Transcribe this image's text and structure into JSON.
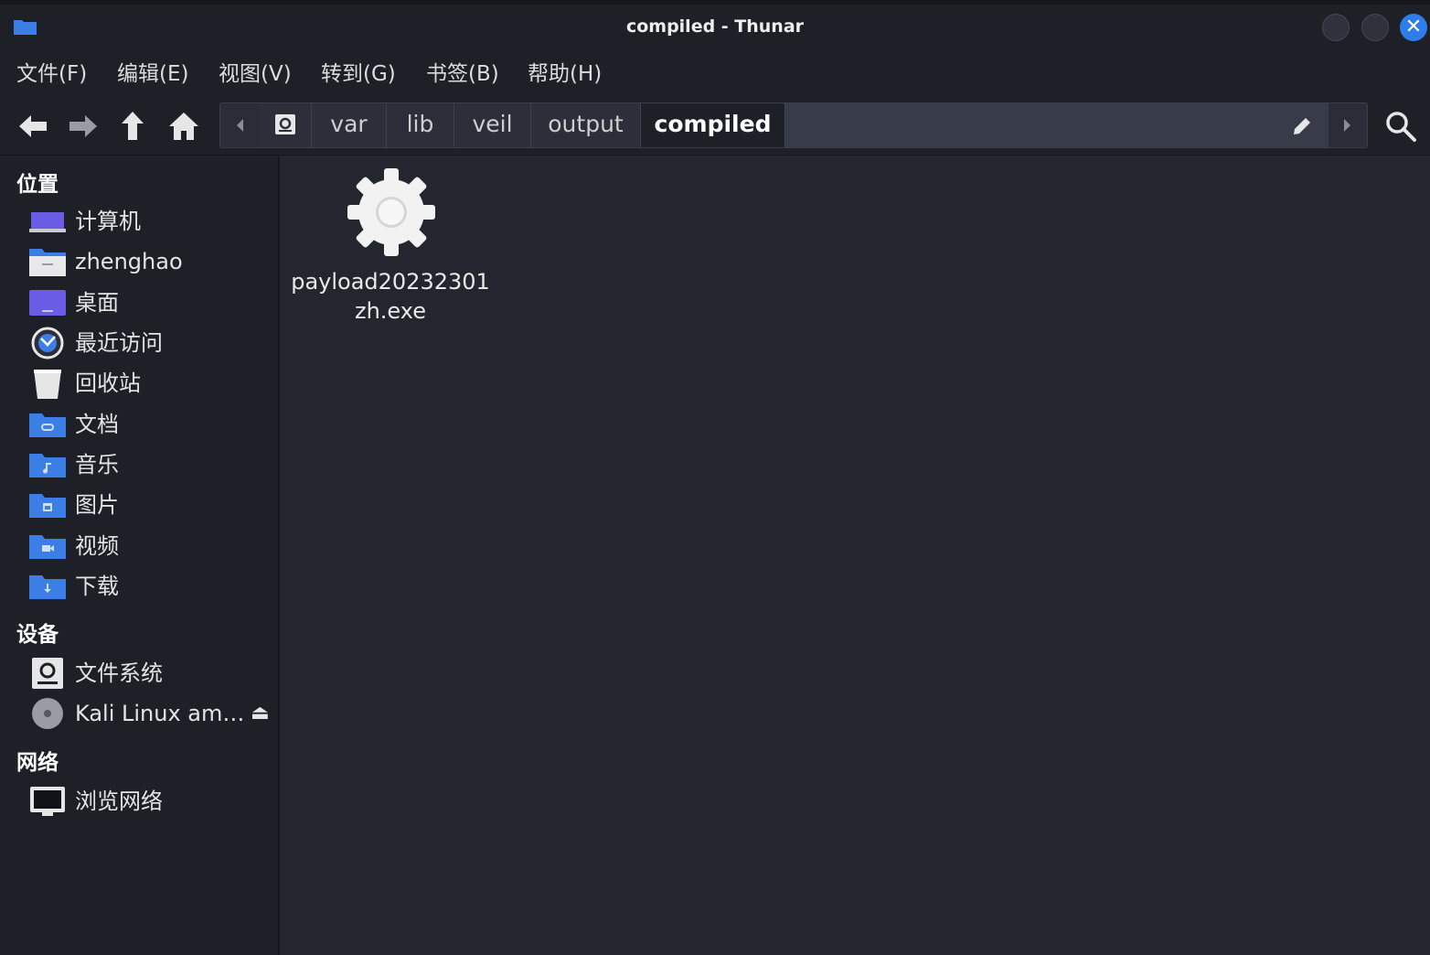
{
  "window": {
    "title": "compiled - Thunar",
    "close_glyph": "✕",
    "icon": "folder-icon"
  },
  "menubar": {
    "items": [
      "文件(F)",
      "编辑(E)",
      "视图(V)",
      "转到(G)",
      "书签(B)",
      "帮助(H)"
    ]
  },
  "toolbar": {
    "icons": [
      "back-arrow-icon",
      "forward-arrow-icon",
      "up-arrow-icon",
      "home-icon",
      "search-icon"
    ]
  },
  "pathbar": {
    "crumbs": [
      "var",
      "lib",
      "veil",
      "output",
      "compiled"
    ],
    "active": "compiled"
  },
  "sidebar": {
    "sections": [
      {
        "title": "位置",
        "items": [
          {
            "label": "计算机",
            "icon": "computer-icon"
          },
          {
            "label": "zhenghao",
            "icon": "home-folder-icon"
          },
          {
            "label": "桌面",
            "icon": "desktop-icon"
          },
          {
            "label": "最近访问",
            "icon": "recent-clock-icon"
          },
          {
            "label": "回收站",
            "icon": "trash-icon"
          },
          {
            "label": "文档",
            "icon": "documents-folder-icon"
          },
          {
            "label": "音乐",
            "icon": "music-folder-icon"
          },
          {
            "label": "图片",
            "icon": "pictures-folder-icon"
          },
          {
            "label": "视频",
            "icon": "videos-folder-icon"
          },
          {
            "label": "下载",
            "icon": "downloads-folder-icon"
          }
        ]
      },
      {
        "title": "设备",
        "items": [
          {
            "label": "文件系统",
            "icon": "filesystem-drive-icon"
          },
          {
            "label": "Kali Linux am…",
            "icon": "optical-disc-icon",
            "eject": "⏏"
          }
        ]
      },
      {
        "title": "网络",
        "items": [
          {
            "label": "浏览网络",
            "icon": "network-monitor-icon"
          }
        ]
      }
    ]
  },
  "files": [
    {
      "name": "payload20232301zh.exe",
      "icon": "executable-gear-icon"
    }
  ],
  "colors": {
    "accent": "#2f7dea",
    "folder_blue": "#3a7ee6",
    "background": "#23262f",
    "panel": "#1e2028"
  }
}
